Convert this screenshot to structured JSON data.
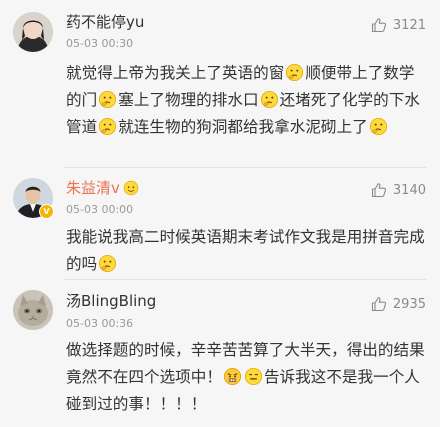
{
  "comments": [
    {
      "username": "药不能停yu",
      "time": "05-03 00:30",
      "likes": "3121",
      "segments": [
        "就觉得上帝为我关上了英语的窗",
        "顺便带上了数学的门",
        "塞上了物理的排水口",
        "还堵死了化学的下水管道",
        "就连生物的狗洞都给我拿水泥砌上了"
      ]
    },
    {
      "username": "朱益清v",
      "time": "05-03 00:00",
      "likes": "3140",
      "segments": [
        "我能说我高二时候英语期末考试作文我是用拼音完成的吗"
      ]
    },
    {
      "username": "汤BlingBling",
      "time": "05-03 00:36",
      "likes": "2935",
      "segments": [
        "做选择题的时候，辛辛苦苦算了大半天，得出的结果竟然不在四个选项中！",
        "告诉我这不是我一个人碰到过的事！！！！"
      ]
    }
  ],
  "icons": {
    "like": "thumbs-up-icon",
    "emoji_think": "thinking-face-emoji",
    "emoji_angry": "angry-face-emoji",
    "emoji_meh": "expressionless-face-emoji"
  },
  "colors": {
    "background": "#f6f6f6",
    "text": "#333333",
    "meta": "#9a9a9a",
    "vip_name": "#eb7350",
    "verified": "#f7b500"
  }
}
